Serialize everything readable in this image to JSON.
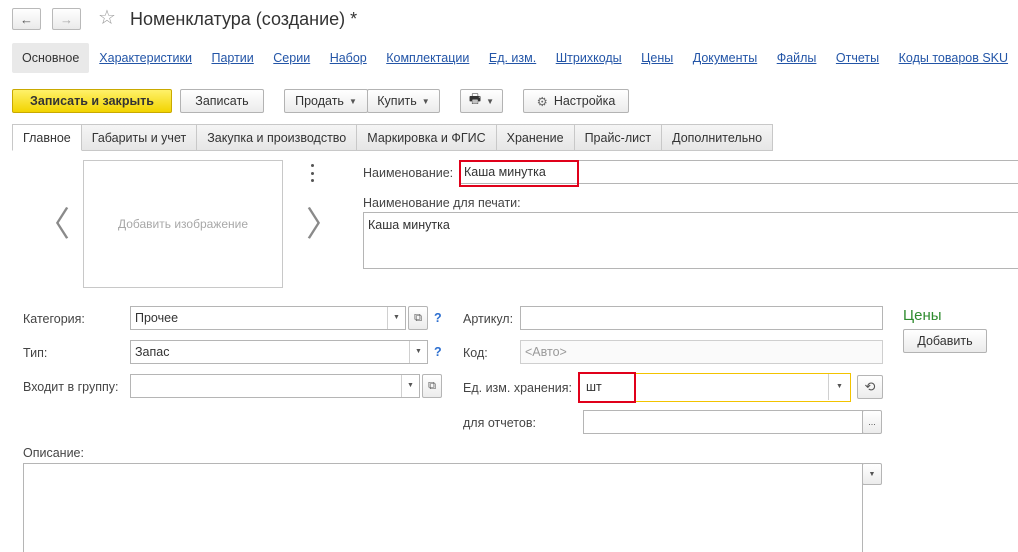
{
  "window": {
    "title": "Номенклатура (создание) *",
    "back_icon": "←",
    "forward_icon": "→",
    "star_icon": "☆"
  },
  "sections": [
    {
      "label": "Основное",
      "active": true
    },
    {
      "label": "Характеристики"
    },
    {
      "label": "Партии"
    },
    {
      "label": "Серии"
    },
    {
      "label": "Набор"
    },
    {
      "label": "Комплектации"
    },
    {
      "label": "Ед. изм."
    },
    {
      "label": "Штрихкоды"
    },
    {
      "label": "Цены"
    },
    {
      "label": "Документы"
    },
    {
      "label": "Файлы"
    },
    {
      "label": "Отчеты"
    },
    {
      "label": "Коды товаров SKU"
    }
  ],
  "toolbar": {
    "save_close": "Записать и закрыть",
    "save": "Записать",
    "sell": "Продать",
    "buy": "Купить",
    "print_icon": "🖶",
    "settings": "Настройка",
    "settings_icon": "⚙"
  },
  "tabs": [
    {
      "label": "Главное",
      "active": true
    },
    {
      "label": "Габариты и учет"
    },
    {
      "label": "Закупка и производство"
    },
    {
      "label": "Маркировка и ФГИС"
    },
    {
      "label": "Хранение"
    },
    {
      "label": "Прайс-лист"
    },
    {
      "label": "Дополнительно"
    }
  ],
  "image": {
    "placeholder": "Добавить изображение",
    "prev_icon": "〈",
    "next_icon": "〉"
  },
  "form": {
    "name_label": "Наименование:",
    "name_value": "Каша минутка",
    "print_name_label": "Наименование для печати:",
    "print_name_value": "Каша минутка",
    "category_label": "Категория:",
    "category_value": "Прочее",
    "type_label": "Тип:",
    "type_value": "Запас",
    "group_label": "Входит в группу:",
    "group_value": "",
    "article_label": "Артикул:",
    "article_value": "",
    "code_label": "Код:",
    "code_value": "<Авто>",
    "unit_label": "Ед. изм. хранения:",
    "unit_value": "шт",
    "reports_label": "для отчетов:",
    "reports_value": "",
    "description_label": "Описание:",
    "description_value": "",
    "help_mark": "?",
    "ellipsis": "...",
    "dropdown_caret": "▼",
    "open_icon": "⧉",
    "history_icon": "⟲"
  },
  "prices": {
    "title": "Цены",
    "add_button": "Добавить"
  },
  "colors": {
    "highlight": "#e0001a",
    "primary_button": "#f2d400",
    "link": "#2355a7",
    "prices_title": "#2e8b2e"
  }
}
